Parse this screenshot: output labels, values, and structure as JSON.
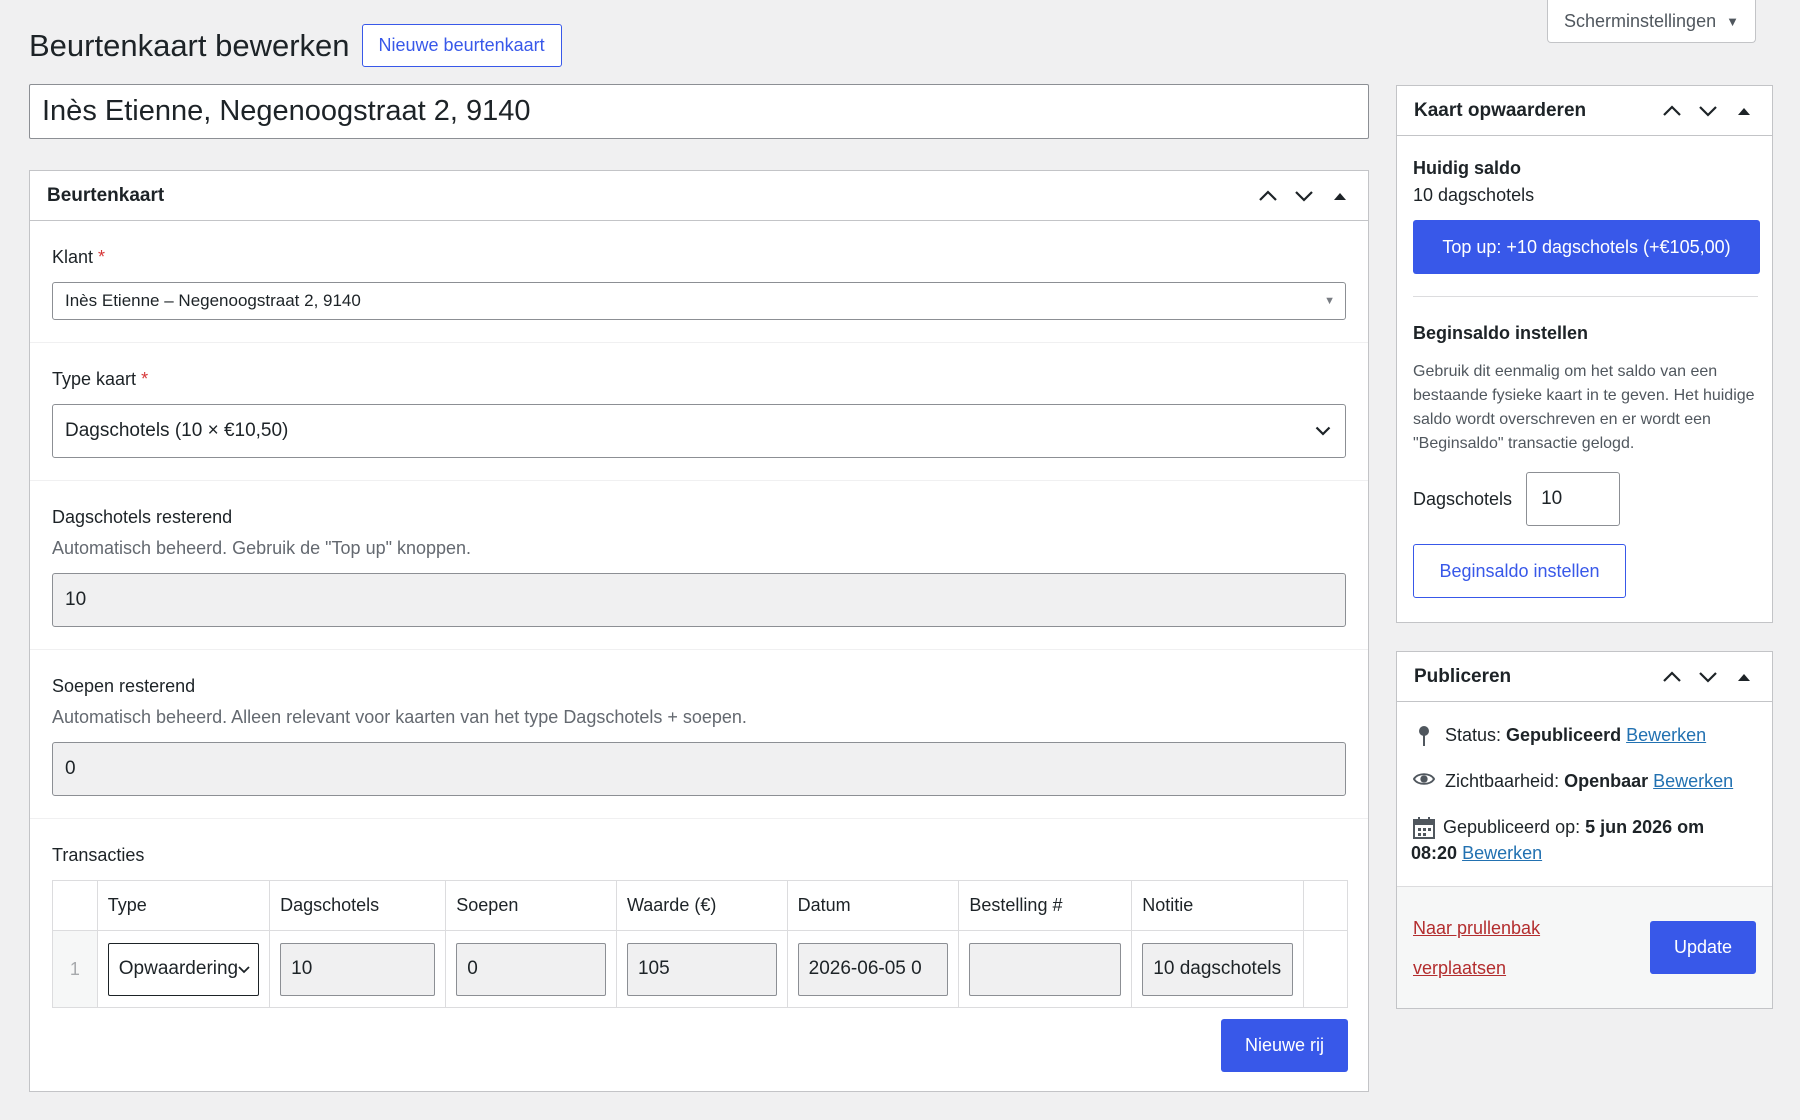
{
  "screen_options": {
    "label": "Scherminstellingen",
    "icon": "caret-down-icon"
  },
  "page": {
    "title": "Beurtenkaart bewerken",
    "add_new_label": "Nieuwe beurtenkaart"
  },
  "post_title": "Inès Etienne, Negenoogstraat 2, 9140",
  "main_box": {
    "title": "Beurtenkaart",
    "klant": {
      "label": "Klant",
      "required": "*",
      "value": "Inès Etienne – Negenoogstraat 2, 9140"
    },
    "type_kaart": {
      "label": "Type kaart",
      "required": "*",
      "value": "Dagschotels (10 × €10,50)"
    },
    "dagschotels": {
      "label": "Dagschotels resterend",
      "description": "Automatisch beheerd. Gebruik de \"Top up\" knoppen.",
      "value": "10"
    },
    "soepen": {
      "label": "Soepen resterend",
      "description": "Automatisch beheerd. Alleen relevant voor kaarten van het type Dagschotels + soepen.",
      "value": "0"
    },
    "transacties": {
      "label": "Transacties",
      "columns": [
        "Type",
        "Dagschotels",
        "Soepen",
        "Waarde (€)",
        "Datum",
        "Bestelling #",
        "Notitie"
      ],
      "rows": [
        {
          "index": "1",
          "type": "Opwaardering",
          "dagschotels": "10",
          "soepen": "0",
          "waarde": "105",
          "datum": "2026-06-05 0",
          "bestelling": "",
          "notitie": "10 dagschotels"
        }
      ],
      "add_row_label": "Nieuwe rij"
    }
  },
  "topup_box": {
    "title": "Kaart opwaarderen",
    "current_label": "Huidig saldo",
    "current_value": "10 dagschotels",
    "topup_button": "Top up: +10 dagschotels (+€105,00)",
    "begin_title": "Beginsaldo instellen",
    "begin_desc": "Gebruik dit eenmalig om het saldo van een bestaande fysieke kaart in te geven. Het huidige saldo wordt overschreven en er wordt een \"Beginsaldo\" transactie gelogd.",
    "dagschotels_label": "Dagschotels",
    "dagschotels_value": "10",
    "begin_button": "Beginsaldo instellen"
  },
  "publish_box": {
    "title": "Publiceren",
    "status_label": "Status:",
    "status_value": "Gepubliceerd",
    "visibility_label": "Zichtbaarheid:",
    "visibility_value": "Openbaar",
    "published_label": "Gepubliceerd op:",
    "published_value_1": "5 jun 2026 om",
    "published_value_2": "08:20",
    "edit_link": "Bewerken",
    "trash_line_1": "Naar prullenbak",
    "trash_line_2": "verplaatsen",
    "update_button": "Update"
  },
  "colors": {
    "accent": "#3858e9",
    "trash": "#b32d2e",
    "required": "#d63638"
  }
}
